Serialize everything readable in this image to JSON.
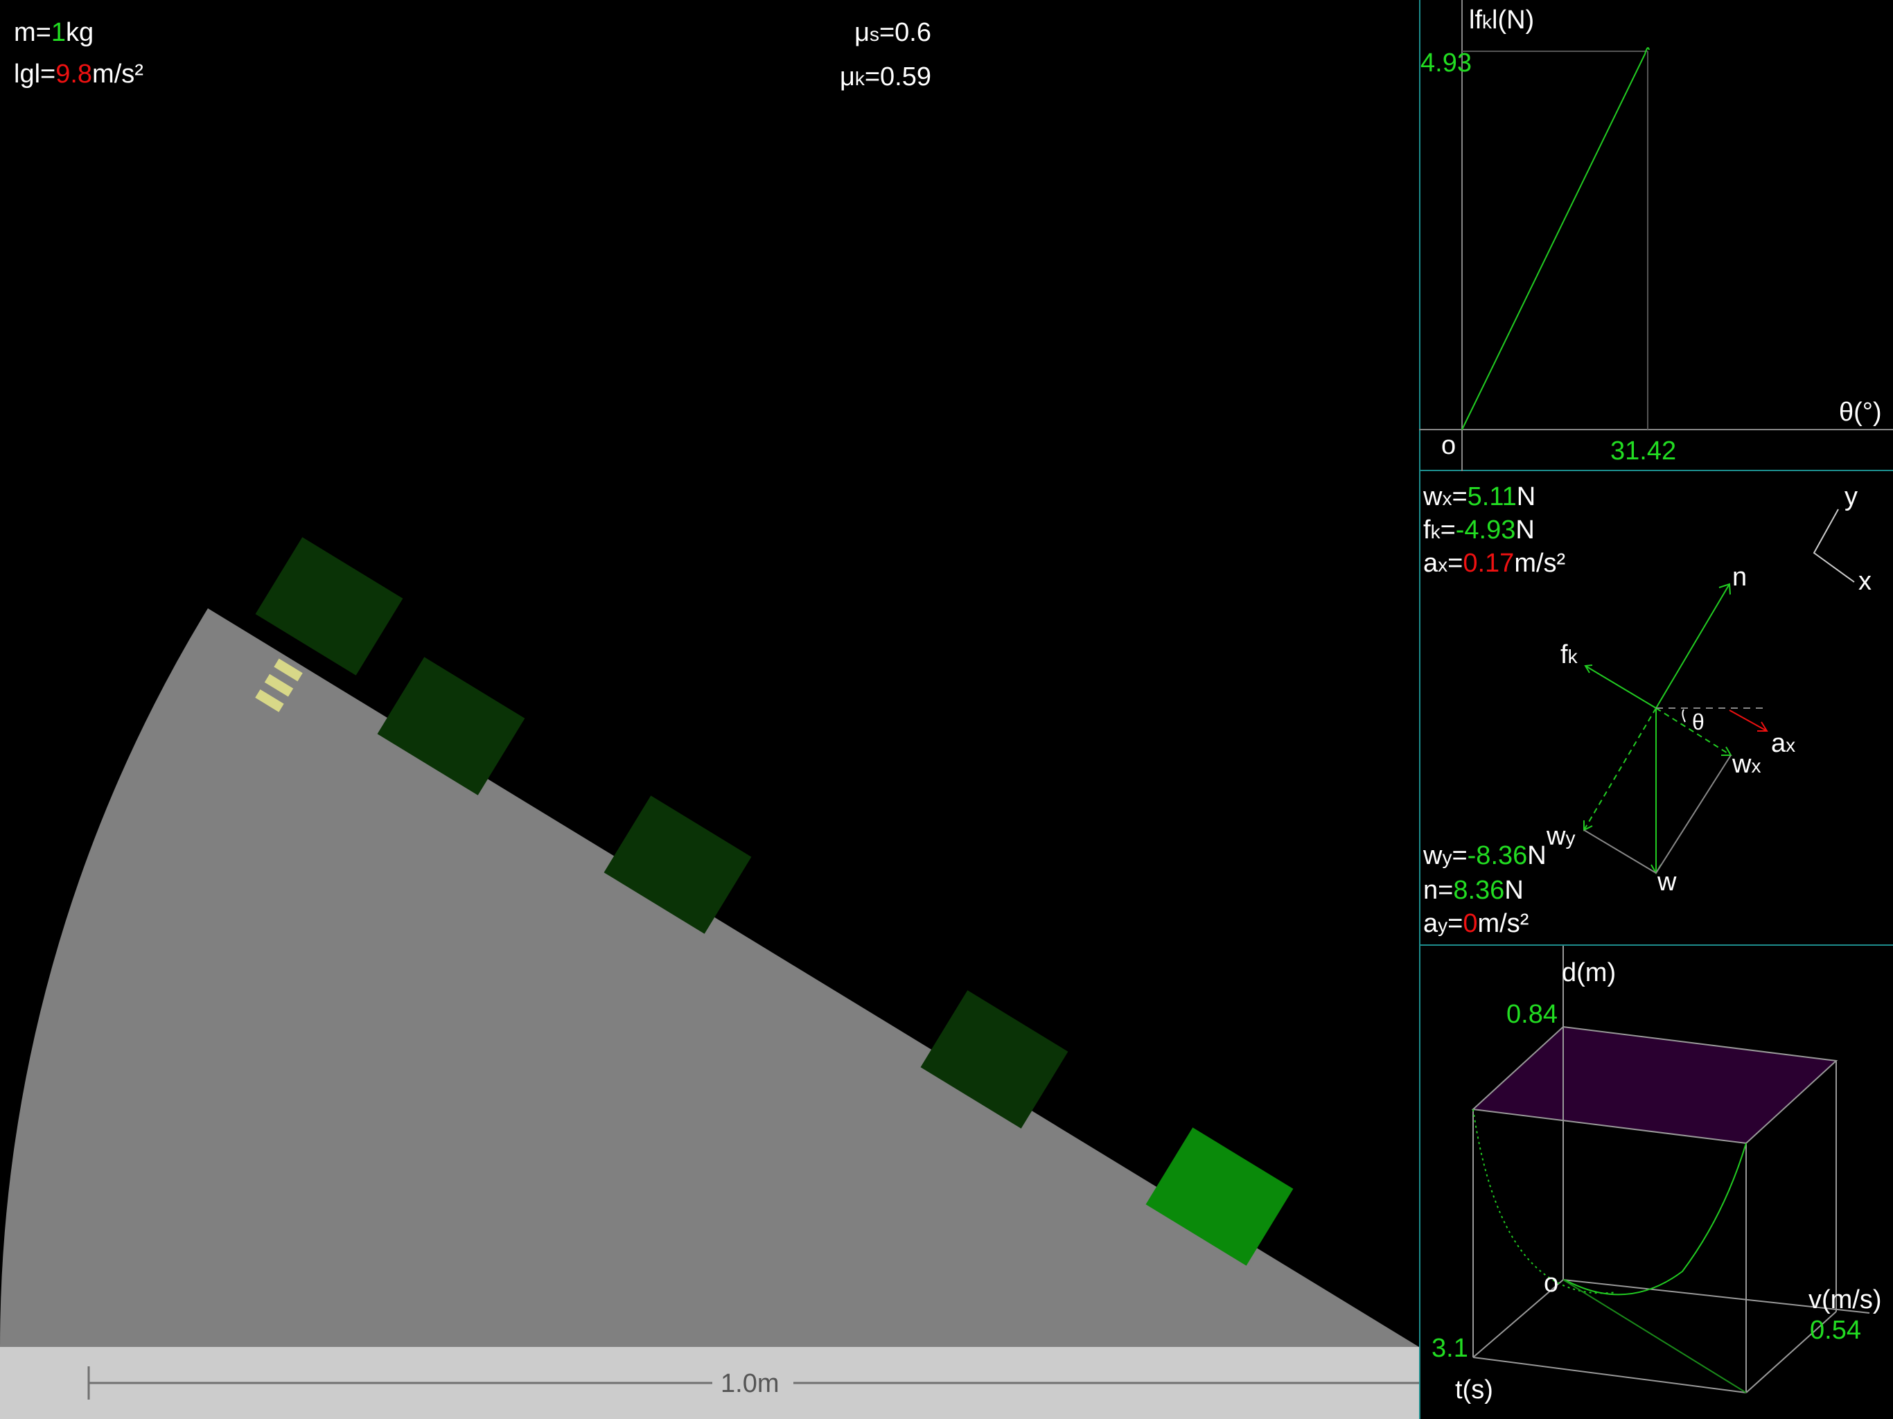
{
  "params": {
    "mass_label": "m=",
    "mass_value": "1",
    "mass_unit": "kg",
    "g_label": "lgl=",
    "g_value": "9.8",
    "g_unit": "m/s²",
    "mus_label": "μ",
    "mus_sub": "s",
    "mus_value": "=0.6",
    "muk_label": "μ",
    "muk_sub": "k",
    "muk_value": "=0.59"
  },
  "scale_bar": {
    "label": "1.0m"
  },
  "colors": {
    "block_ghost": "#0a3306",
    "block_active": "#0a8a0a",
    "incline": "#808080",
    "floor": "#cccccc",
    "plot_green": "#22cc22",
    "accent_red": "#ee1111",
    "panel_border": "#1d8d8d",
    "plane_purple": "#2a0030"
  },
  "friction_graph": {
    "y_label_pre": "lf",
    "y_label_sub": "k",
    "y_label_post": "l(N)",
    "y_max_label": "4.93",
    "x_label": "θ(°)",
    "origin": "o",
    "x_max_label": "31.42"
  },
  "force_panel": {
    "wx_pre": "w",
    "wx_sub": "x",
    "wx_eq": "=",
    "wx_val": "5.11",
    "wx_unit": "N",
    "fk_pre": "f",
    "fk_sub": "k",
    "fk_eq": "=",
    "fk_val": "-4.93",
    "fk_unit": "N",
    "ax_pre": "a",
    "ax_sub": "x",
    "ax_eq": "=",
    "ax_val": "0.17",
    "ax_unit": "m/s²",
    "wy_pre": "w",
    "wy_sub": "y",
    "wy_eq": "=",
    "wy_val": "-8.36",
    "wy_unit": "N",
    "n_pre": "n",
    "n_eq": "=",
    "n_val": "8.36",
    "n_unit": "N",
    "ay_pre": "a",
    "ay_sub": "y",
    "ay_eq": "=",
    "ay_val": "0",
    "ay_unit": "m/s²",
    "axis_y": "y",
    "axis_x": "x",
    "lbl_n": "n",
    "lbl_fk": "f",
    "lbl_fk_sub": "k",
    "lbl_theta": "θ",
    "lbl_ax": "a",
    "lbl_ax_sub": "x",
    "lbl_wx": "w",
    "lbl_wx_sub": "x",
    "lbl_wy": "w",
    "lbl_wy_sub": "y",
    "lbl_w": "w"
  },
  "graph3d": {
    "d_label": "d(m)",
    "d_max": "0.84",
    "origin": "o",
    "v_label": "v(m/s)",
    "v_max": "0.54",
    "t_label": "t(s)",
    "t_max": "3.1"
  }
}
